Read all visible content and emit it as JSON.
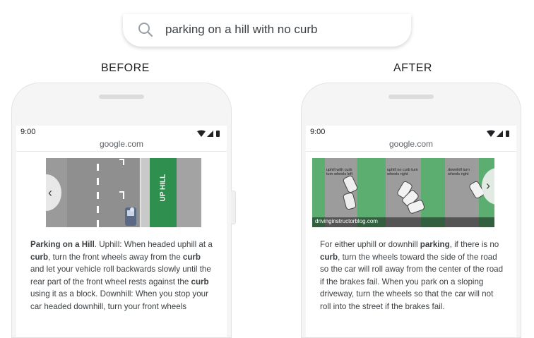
{
  "search": {
    "query": "parking on a hill with no curb"
  },
  "labels": {
    "before": "BEFORE",
    "after": "AFTER"
  },
  "before_phone": {
    "time": "9:00",
    "url": "google.com",
    "image_text": "UP HILL",
    "snippet": [
      {
        "t": "Parking on a Hill",
        "b": true
      },
      {
        "t": ". Uphill: When headed uphill at a ",
        "b": false
      },
      {
        "t": "curb",
        "b": true
      },
      {
        "t": ", turn the front wheels away from the ",
        "b": false
      },
      {
        "t": "curb",
        "b": true
      },
      {
        "t": " and let your vehicle roll backwards slowly until the rear part of the front wheel rests against the ",
        "b": false
      },
      {
        "t": "curb",
        "b": true
      },
      {
        "t": " using it as a block. Downhill: When you stop your car headed downhill, turn your front wheels",
        "b": false
      }
    ]
  },
  "after_phone": {
    "time": "9:00",
    "url": "google.com",
    "image_labels": [
      "uphill with curb turn wheels left",
      "uphill no curb turn wheels right",
      "downhill turn wheels right"
    ],
    "image_watermark": "drivinginstructorblog.com",
    "snippet": [
      {
        "t": "For either uphill or downhill ",
        "b": false
      },
      {
        "t": "parking",
        "b": true
      },
      {
        "t": ", if there is no ",
        "b": false
      },
      {
        "t": "curb",
        "b": true
      },
      {
        "t": ", turn the wheels toward the side of the road so the car will roll away from the center of the road if the brakes fail. When you park on a sloping driveway, turn the wheels so that the car will not roll into the street if the brakes fail.",
        "b": false
      }
    ]
  },
  "colors": {
    "accent_green": "#2f8f4e",
    "road_gray": "#9a9a9a",
    "photo_green": "#5cad70"
  }
}
